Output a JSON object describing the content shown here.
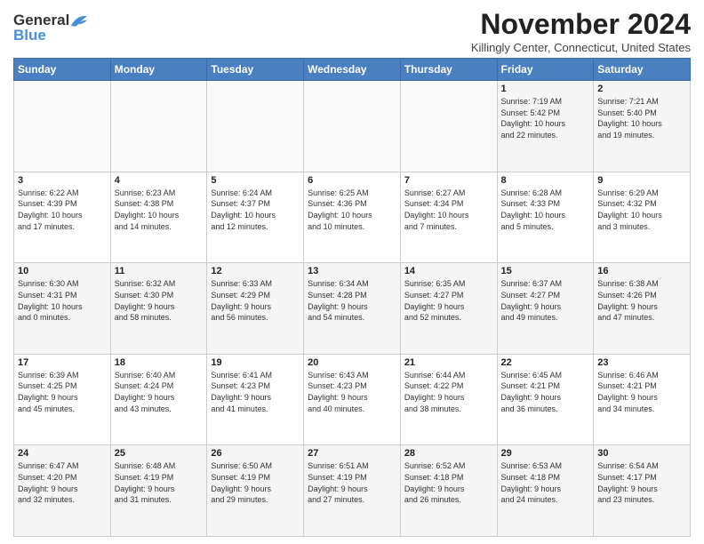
{
  "logo": {
    "line1": "General",
    "line2": "Blue"
  },
  "title": "November 2024",
  "location": "Killingly Center, Connecticut, United States",
  "days_of_week": [
    "Sunday",
    "Monday",
    "Tuesday",
    "Wednesday",
    "Thursday",
    "Friday",
    "Saturday"
  ],
  "weeks": [
    [
      {
        "day": "",
        "info": ""
      },
      {
        "day": "",
        "info": ""
      },
      {
        "day": "",
        "info": ""
      },
      {
        "day": "",
        "info": ""
      },
      {
        "day": "",
        "info": ""
      },
      {
        "day": "1",
        "info": "Sunrise: 7:19 AM\nSunset: 5:42 PM\nDaylight: 10 hours\nand 22 minutes."
      },
      {
        "day": "2",
        "info": "Sunrise: 7:21 AM\nSunset: 5:40 PM\nDaylight: 10 hours\nand 19 minutes."
      }
    ],
    [
      {
        "day": "3",
        "info": "Sunrise: 6:22 AM\nSunset: 4:39 PM\nDaylight: 10 hours\nand 17 minutes."
      },
      {
        "day": "4",
        "info": "Sunrise: 6:23 AM\nSunset: 4:38 PM\nDaylight: 10 hours\nand 14 minutes."
      },
      {
        "day": "5",
        "info": "Sunrise: 6:24 AM\nSunset: 4:37 PM\nDaylight: 10 hours\nand 12 minutes."
      },
      {
        "day": "6",
        "info": "Sunrise: 6:25 AM\nSunset: 4:36 PM\nDaylight: 10 hours\nand 10 minutes."
      },
      {
        "day": "7",
        "info": "Sunrise: 6:27 AM\nSunset: 4:34 PM\nDaylight: 10 hours\nand 7 minutes."
      },
      {
        "day": "8",
        "info": "Sunrise: 6:28 AM\nSunset: 4:33 PM\nDaylight: 10 hours\nand 5 minutes."
      },
      {
        "day": "9",
        "info": "Sunrise: 6:29 AM\nSunset: 4:32 PM\nDaylight: 10 hours\nand 3 minutes."
      }
    ],
    [
      {
        "day": "10",
        "info": "Sunrise: 6:30 AM\nSunset: 4:31 PM\nDaylight: 10 hours\nand 0 minutes."
      },
      {
        "day": "11",
        "info": "Sunrise: 6:32 AM\nSunset: 4:30 PM\nDaylight: 9 hours\nand 58 minutes."
      },
      {
        "day": "12",
        "info": "Sunrise: 6:33 AM\nSunset: 4:29 PM\nDaylight: 9 hours\nand 56 minutes."
      },
      {
        "day": "13",
        "info": "Sunrise: 6:34 AM\nSunset: 4:28 PM\nDaylight: 9 hours\nand 54 minutes."
      },
      {
        "day": "14",
        "info": "Sunrise: 6:35 AM\nSunset: 4:27 PM\nDaylight: 9 hours\nand 52 minutes."
      },
      {
        "day": "15",
        "info": "Sunrise: 6:37 AM\nSunset: 4:27 PM\nDaylight: 9 hours\nand 49 minutes."
      },
      {
        "day": "16",
        "info": "Sunrise: 6:38 AM\nSunset: 4:26 PM\nDaylight: 9 hours\nand 47 minutes."
      }
    ],
    [
      {
        "day": "17",
        "info": "Sunrise: 6:39 AM\nSunset: 4:25 PM\nDaylight: 9 hours\nand 45 minutes."
      },
      {
        "day": "18",
        "info": "Sunrise: 6:40 AM\nSunset: 4:24 PM\nDaylight: 9 hours\nand 43 minutes."
      },
      {
        "day": "19",
        "info": "Sunrise: 6:41 AM\nSunset: 4:23 PM\nDaylight: 9 hours\nand 41 minutes."
      },
      {
        "day": "20",
        "info": "Sunrise: 6:43 AM\nSunset: 4:23 PM\nDaylight: 9 hours\nand 40 minutes."
      },
      {
        "day": "21",
        "info": "Sunrise: 6:44 AM\nSunset: 4:22 PM\nDaylight: 9 hours\nand 38 minutes."
      },
      {
        "day": "22",
        "info": "Sunrise: 6:45 AM\nSunset: 4:21 PM\nDaylight: 9 hours\nand 36 minutes."
      },
      {
        "day": "23",
        "info": "Sunrise: 6:46 AM\nSunset: 4:21 PM\nDaylight: 9 hours\nand 34 minutes."
      }
    ],
    [
      {
        "day": "24",
        "info": "Sunrise: 6:47 AM\nSunset: 4:20 PM\nDaylight: 9 hours\nand 32 minutes."
      },
      {
        "day": "25",
        "info": "Sunrise: 6:48 AM\nSunset: 4:19 PM\nDaylight: 9 hours\nand 31 minutes."
      },
      {
        "day": "26",
        "info": "Sunrise: 6:50 AM\nSunset: 4:19 PM\nDaylight: 9 hours\nand 29 minutes."
      },
      {
        "day": "27",
        "info": "Sunrise: 6:51 AM\nSunset: 4:19 PM\nDaylight: 9 hours\nand 27 minutes."
      },
      {
        "day": "28",
        "info": "Sunrise: 6:52 AM\nSunset: 4:18 PM\nDaylight: 9 hours\nand 26 minutes."
      },
      {
        "day": "29",
        "info": "Sunrise: 6:53 AM\nSunset: 4:18 PM\nDaylight: 9 hours\nand 24 minutes."
      },
      {
        "day": "30",
        "info": "Sunrise: 6:54 AM\nSunset: 4:17 PM\nDaylight: 9 hours\nand 23 minutes."
      }
    ]
  ]
}
